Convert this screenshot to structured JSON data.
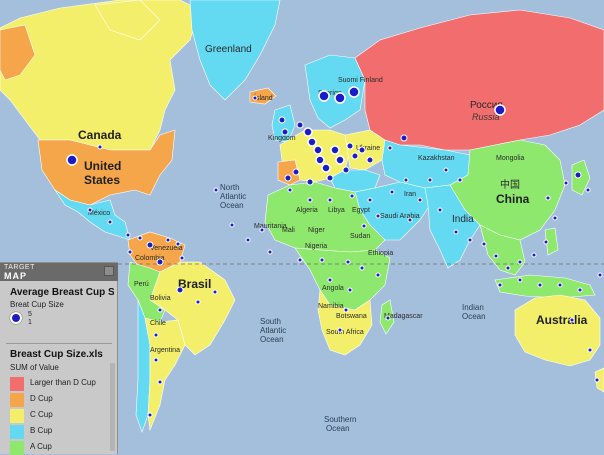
{
  "map": {
    "colors": {
      "ocean": "#a4bfdc",
      "larger_than_d": "#f26d6d",
      "d_cup": "#f5a64a",
      "c_cup": "#f3ef6a",
      "b_cup": "#64d9f2",
      "a_cup": "#8ee86e",
      "marker": "#1c1cc6"
    },
    "countries": {
      "canada": "Canada",
      "united_states_line1": "United",
      "united_states_line2": "States",
      "brasil": "Brasil",
      "australia": "Australia",
      "china": "China",
      "china_native": "中国",
      "russia_native": "Россия",
      "russia": "Russia",
      "india": "India",
      "kazakhstan": "Kazakhstan",
      "mongolia": "Mongolia",
      "greenland": "Greenland",
      "iceland": "Ísland",
      "suomi_finland": "Suomi Finland",
      "algeria": "Algeria",
      "libya": "Libya",
      "egypt": "Egypt",
      "sudan": "Sudan",
      "niger": "Niger",
      "mali": "Mali",
      "nigeria": "Nigeria",
      "ethiopia": "Ethiopia",
      "saudi_arabia": "Saudi Arabia",
      "iran": "Iran",
      "mauritania": "Mauritania",
      "namibia": "Namibia",
      "botswana": "Botswana",
      "south_africa": "South Africa",
      "madagascar": "Madagascar",
      "angola": "Angola",
      "bolivia": "Bolivia",
      "peru": "Perú",
      "chile": "Chile",
      "argentina": "Argentina",
      "venezuela": "Venezuela",
      "colombia": "Colombia",
      "mexico": "México",
      "ukraine": "Ukraine",
      "sverige": "Sverige",
      "kingdom": "Kingdom"
    },
    "oceans": {
      "north_atlantic": [
        "North",
        "Atlantic",
        "Ocean"
      ],
      "south_atlantic": [
        "South",
        "Atlantic",
        "Ocean"
      ],
      "indian": [
        "Indian",
        "Ocean"
      ],
      "southern": [
        "Southern",
        "Ocean"
      ]
    }
  },
  "legend": {
    "brand_top": "TARGET",
    "brand_bottom": "MAP",
    "title": "Average Breast Cup Size",
    "subtitle": "Breat Cup Size",
    "marker_max": "5",
    "marker_min": "1",
    "source_title": "Breast Cup Size.xls",
    "aggregate_label": "SUM of Value",
    "items": [
      {
        "label": "Larger than D Cup",
        "color": "#f26d6d"
      },
      {
        "label": "D Cup",
        "color": "#f5a64a"
      },
      {
        "label": "C Cup",
        "color": "#f3ef6a"
      },
      {
        "label": "B Cup",
        "color": "#64d9f2"
      },
      {
        "label": "A Cup",
        "color": "#8ee86e"
      }
    ]
  }
}
